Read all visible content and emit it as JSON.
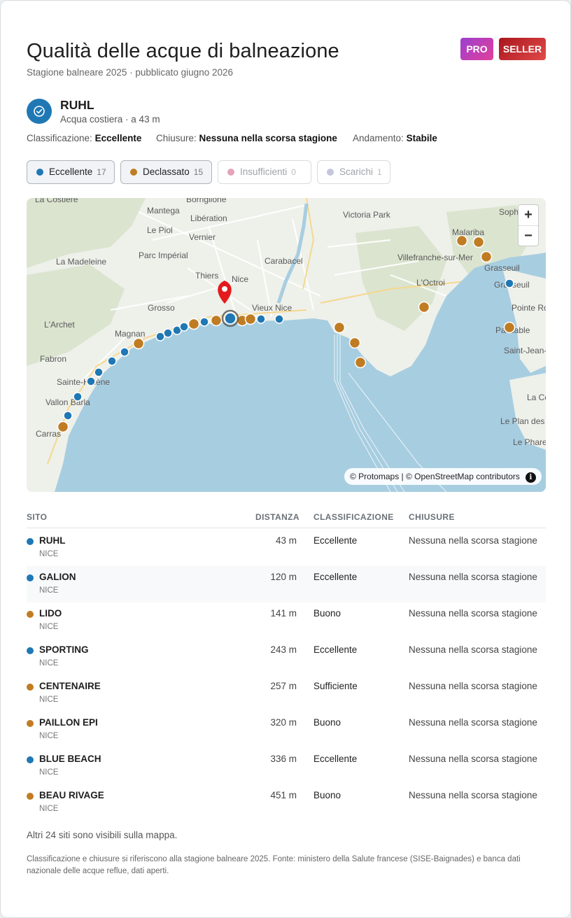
{
  "header": {
    "title": "Qualità delle acque di balneazione",
    "subtitle": "Stagione balneare 2025 · pubblicato giugno 2026",
    "badges": {
      "pro": "PRO",
      "seller": "SELLER"
    }
  },
  "selected_site": {
    "icon": "check-circle-icon",
    "name": "RUHL",
    "subtitle": "Acqua costiera · a 43 m",
    "meta": [
      {
        "label": "Classificazione:",
        "value": "Eccellente"
      },
      {
        "label": "Chiusure:",
        "value": "Nessuna nella scorsa stagione"
      },
      {
        "label": "Andamento:",
        "value": "Stabile"
      }
    ]
  },
  "colors": {
    "excellent": "#1f78b4",
    "downgraded": "#c07c22",
    "insufficient": "#e5a3b8",
    "discharge": "#c3c6dd",
    "sea": "#a7cde0",
    "marker": "#e41a1c"
  },
  "filters": [
    {
      "label": "Eccellente",
      "count": "17",
      "color": "#1f78b4",
      "active": true
    },
    {
      "label": "Declassato",
      "count": "15",
      "color": "#c07c22",
      "active": true
    },
    {
      "label": "Insufficienti",
      "count": "0",
      "color": "#e5a3b8",
      "active": false
    },
    {
      "label": "Scarichi",
      "count": "1",
      "color": "#c3c6dd",
      "active": false
    }
  ],
  "map": {
    "zoom_in": "+",
    "zoom_out": "−",
    "attribution": "© Protomaps | © OpenStreetMap contributors",
    "info": "i",
    "places": [
      "La Costière",
      "Borriglione",
      "Mantega",
      "Libération",
      "Victoria Park",
      "Sophia",
      "Le Piol",
      "Vernier",
      "Malariba",
      "La Madeleine",
      "Parc Impérial",
      "Carabacel",
      "Villefranche-sur-Mer",
      "Grasseuil",
      "Thiers",
      "Nice",
      "L'Octroi",
      "Grasseuil",
      "Grosso",
      "Vieux Nice",
      "Pointe Ro",
      "L'Archet",
      "Magnan",
      "Passable",
      "Saint-Jean-C",
      "Fabron",
      "Sainte-Hélène",
      "La Co",
      "Vallon Barla",
      "Le Plan des",
      "Carras",
      "Le Phare"
    ]
  },
  "table": {
    "headers": {
      "site": "SITO",
      "distance": "DISTANZA",
      "classification": "CLASSIFICAZIONE",
      "closures": "CHIUSURE"
    },
    "rows": [
      {
        "name": "RUHL",
        "city": "NICE",
        "distance": "43 m",
        "classification": "Eccellente",
        "closures": "Nessuna nella scorsa stagione",
        "status": "excellent"
      },
      {
        "name": "GALION",
        "city": "NICE",
        "distance": "120 m",
        "classification": "Eccellente",
        "closures": "Nessuna nella scorsa stagione",
        "status": "excellent"
      },
      {
        "name": "LIDO",
        "city": "NICE",
        "distance": "141 m",
        "classification": "Buono",
        "closures": "Nessuna nella scorsa stagione",
        "status": "downgraded"
      },
      {
        "name": "SPORTING",
        "city": "NICE",
        "distance": "243 m",
        "classification": "Eccellente",
        "closures": "Nessuna nella scorsa stagione",
        "status": "excellent"
      },
      {
        "name": "CENTENAIRE",
        "city": "NICE",
        "distance": "257 m",
        "classification": "Sufficiente",
        "closures": "Nessuna nella scorsa stagione",
        "status": "downgraded"
      },
      {
        "name": "PAILLON EPI",
        "city": "NICE",
        "distance": "320 m",
        "classification": "Buono",
        "closures": "Nessuna nella scorsa stagione",
        "status": "downgraded"
      },
      {
        "name": "BLUE BEACH",
        "city": "NICE",
        "distance": "336 m",
        "classification": "Eccellente",
        "closures": "Nessuna nella scorsa stagione",
        "status": "excellent"
      },
      {
        "name": "BEAU RIVAGE",
        "city": "NICE",
        "distance": "451 m",
        "classification": "Buono",
        "closures": "Nessuna nella scorsa stagione",
        "status": "downgraded"
      }
    ]
  },
  "more_text": "Altri 24 siti sono visibili sulla mappa.",
  "footnote": "Classificazione e chiusure si riferiscono alla stagione balneare 2025. Fonte: ministero della Salute francese (SISE-Baignades) e banca dati nazionale delle acque reflue, dati aperti."
}
